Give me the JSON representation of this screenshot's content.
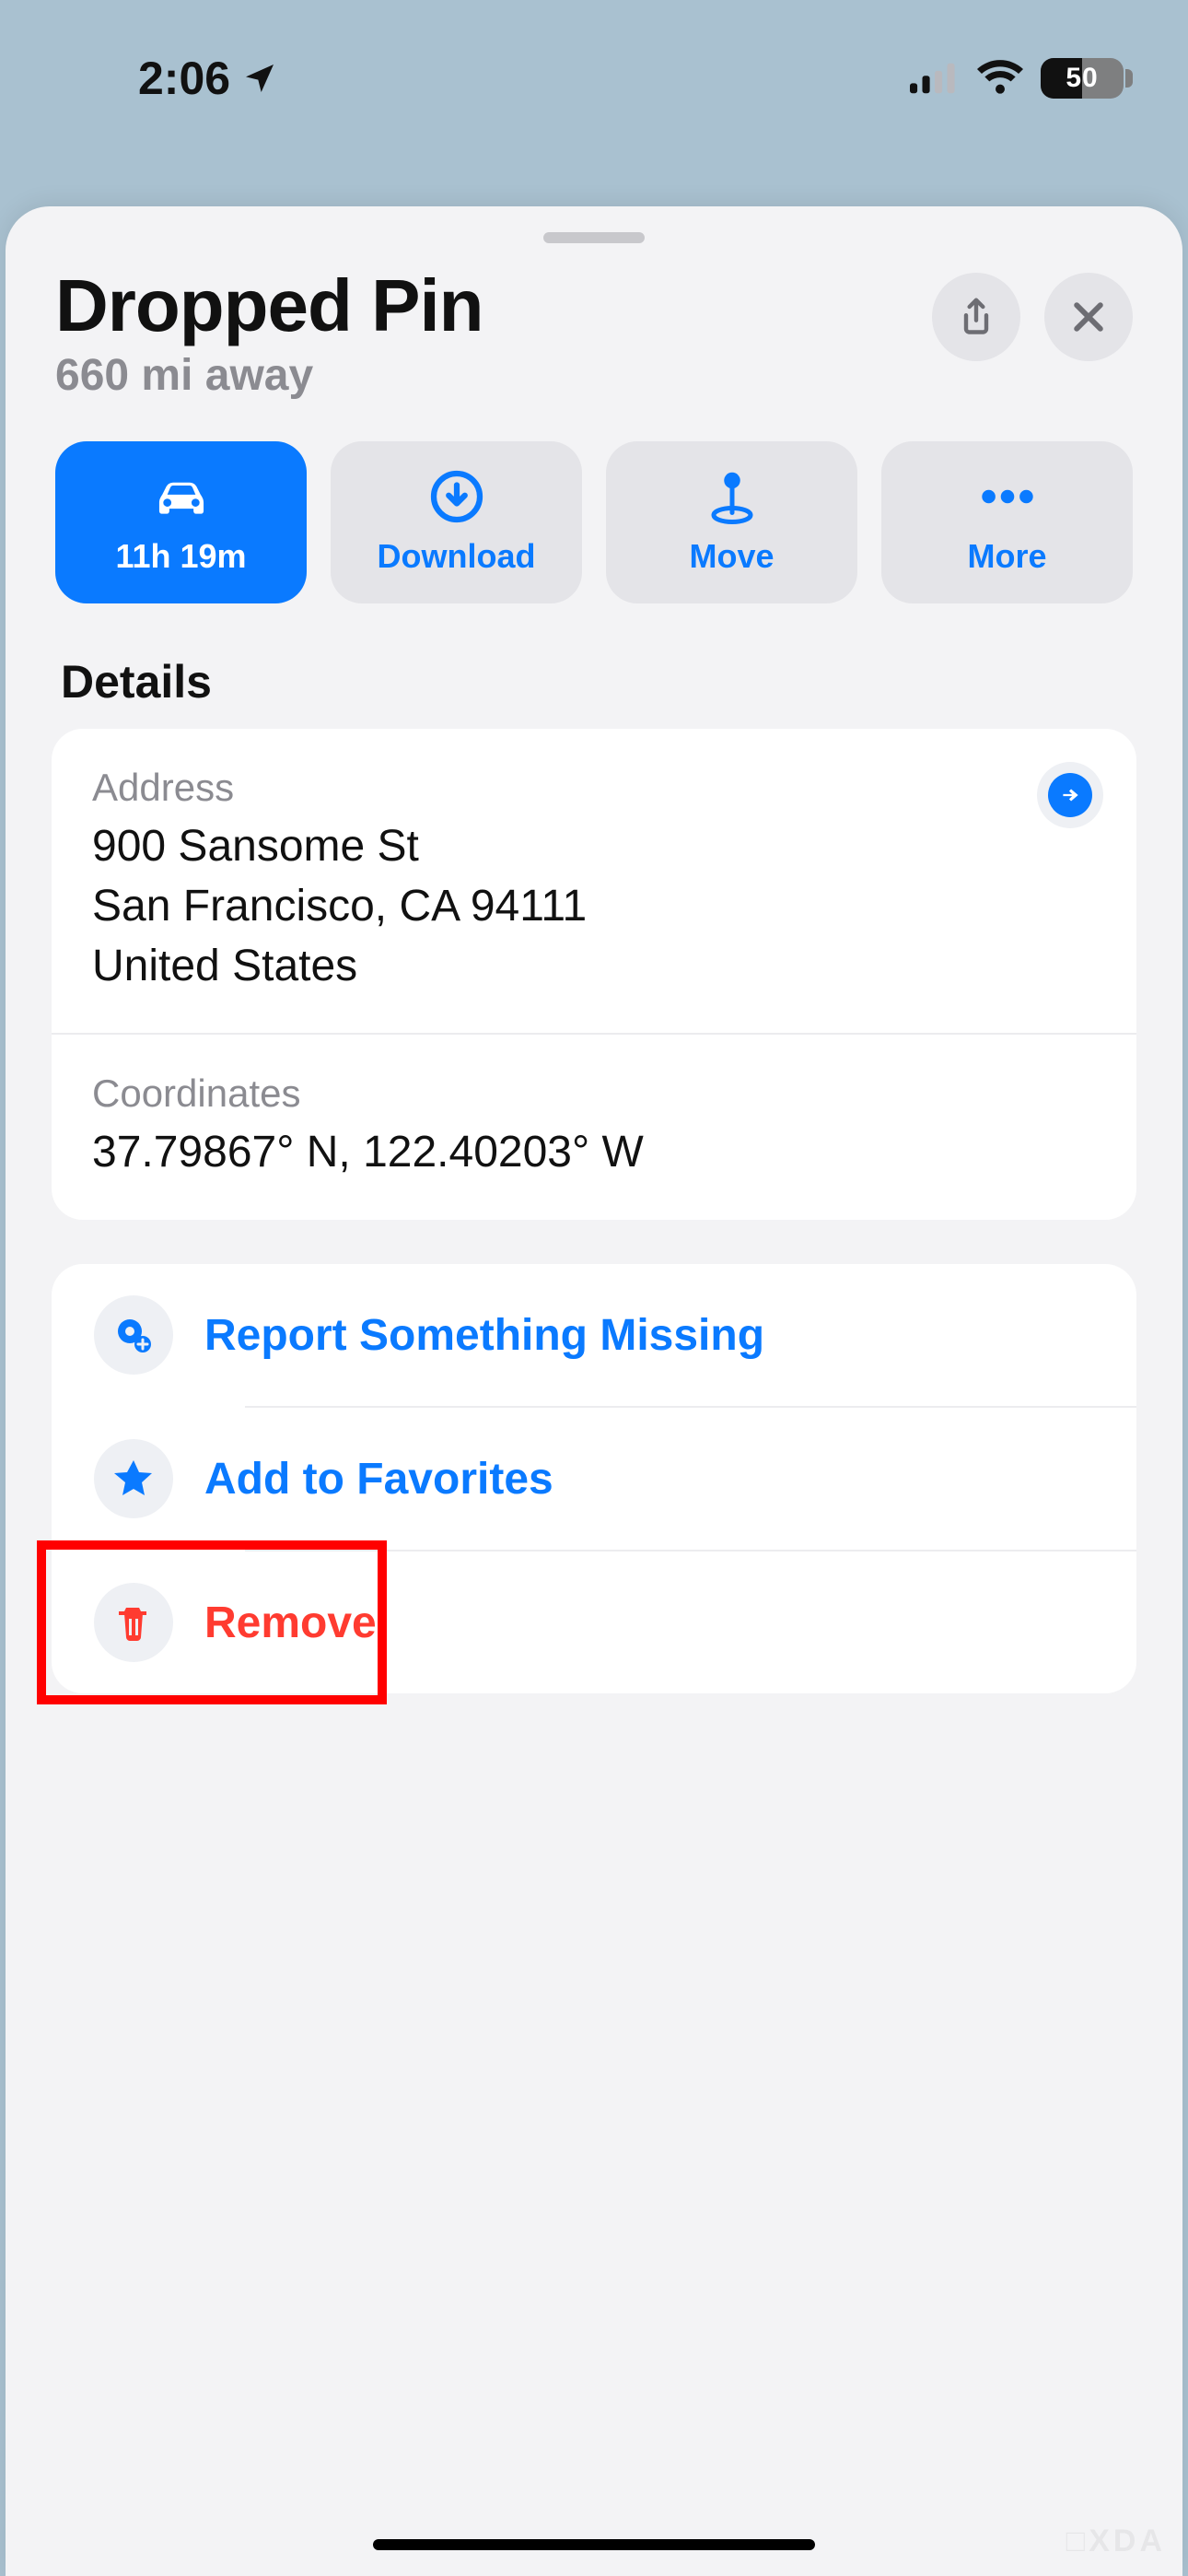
{
  "status": {
    "time": "2:06",
    "battery_text": "50"
  },
  "header": {
    "title": "Dropped Pin",
    "subtitle": "660 mi away"
  },
  "actions": {
    "drive": {
      "label": "11h 19m"
    },
    "download": {
      "label": "Download"
    },
    "move": {
      "label": "Move"
    },
    "more": {
      "label": "More"
    }
  },
  "details": {
    "heading": "Details",
    "address": {
      "label": "Address",
      "line1": "900 Sansome St",
      "line2": "San Francisco, CA  94111",
      "line3": "United States"
    },
    "coordinates": {
      "label": "Coordinates",
      "value": "37.79867° N, 122.40203° W"
    }
  },
  "list": {
    "report": "Report Something Missing",
    "favorite": "Add to Favorites",
    "remove": "Remove"
  },
  "watermark": "□XDA"
}
